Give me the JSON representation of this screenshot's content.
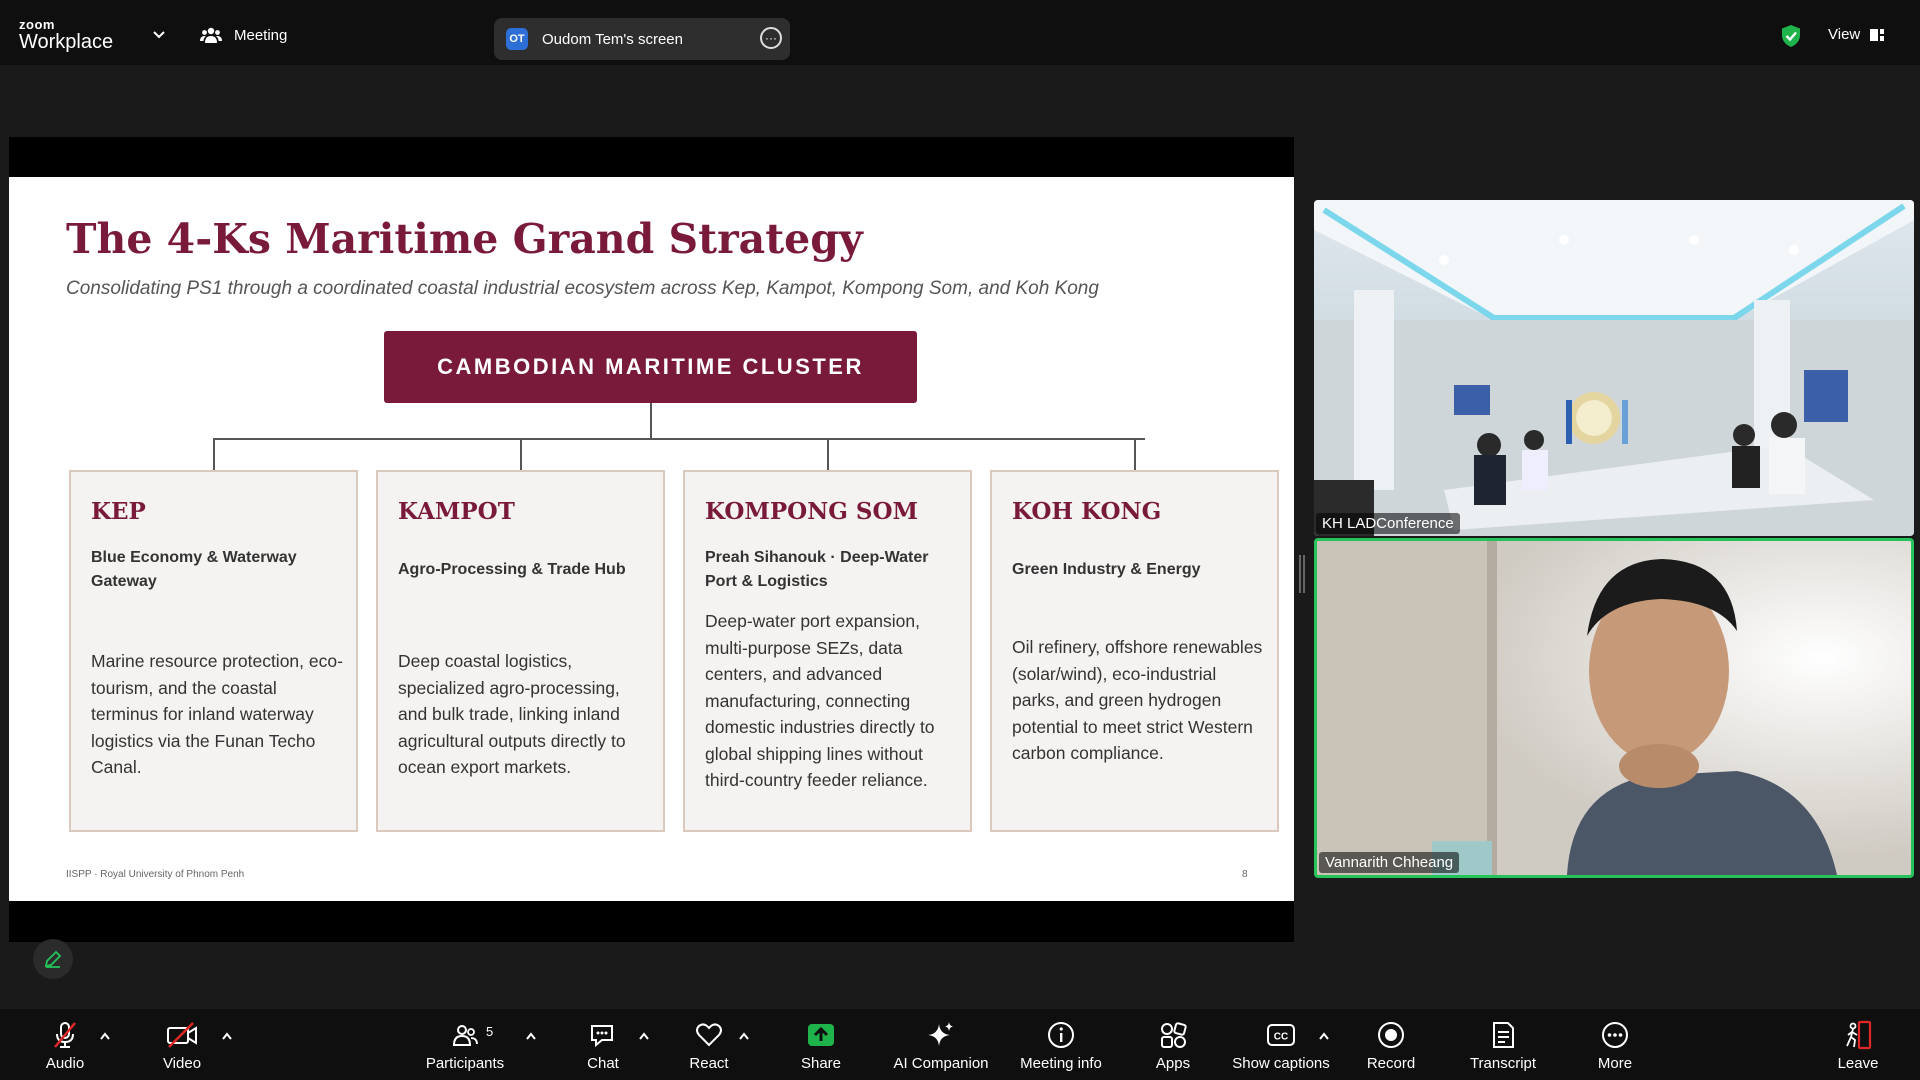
{
  "app": {
    "logo_small": "zoom",
    "logo_big": "Workplace",
    "meeting_label": "Meeting",
    "share_badge": "OT",
    "share_title": "Oudom Tem's screen",
    "view_label": "View",
    "colors": {
      "accent_green": "#25c45a",
      "share_green": "#1fb34b",
      "leave_red": "#e02828",
      "slide_maroon": "#7a1a3a"
    }
  },
  "slide": {
    "title": "The 4-Ks Maritime Grand Strategy",
    "subtitle": "Consolidating PS1 through a coordinated coastal industrial ecosystem across Kep, Kampot, Kompong Som, and Koh Kong",
    "cluster": "CAMBODIAN MARITIME CLUSTER",
    "cards": [
      {
        "title": "KEP",
        "subtitle": "Blue Economy & Waterway Gateway",
        "body": "Marine resource protection, eco-tourism, and the coastal terminus for inland waterway logistics via the Funan Techo Canal."
      },
      {
        "title": "KAMPOT",
        "subtitle": "Agro-Processing & Trade Hub",
        "body": "Deep coastal logistics, specialized agro-processing, and bulk trade, linking inland agricultural outputs directly to ocean export markets."
      },
      {
        "title": "KOMPONG SOM",
        "subtitle": "Preah Sihanouk · Deep-Water Port & Logistics",
        "body": "Deep-water port expansion, multi-purpose SEZs, data centers, and advanced manufacturing, connecting domestic industries directly to global shipping lines without third-country feeder reliance."
      },
      {
        "title": "KOH KONG",
        "subtitle": "Green Industry & Energy",
        "body": "Oil refinery, offshore renewables (solar/wind), eco-industrial parks, and green hydrogen potential to meet strict Western carbon compliance."
      }
    ],
    "footer": "IISPP · Royal University of Phnom Penh",
    "page_number": "8"
  },
  "participants": {
    "tile1_name": "KH LADConference",
    "tile2_name": "Vannarith Chheang"
  },
  "toolbar": {
    "audio": "Audio",
    "video": "Video",
    "participants": "Participants",
    "participants_count": "5",
    "chat": "Chat",
    "react": "React",
    "share": "Share",
    "ai_companion": "AI Companion",
    "meeting_info": "Meeting info",
    "apps": "Apps",
    "show_captions": "Show captions",
    "record": "Record",
    "transcript": "Transcript",
    "more": "More",
    "leave": "Leave"
  }
}
